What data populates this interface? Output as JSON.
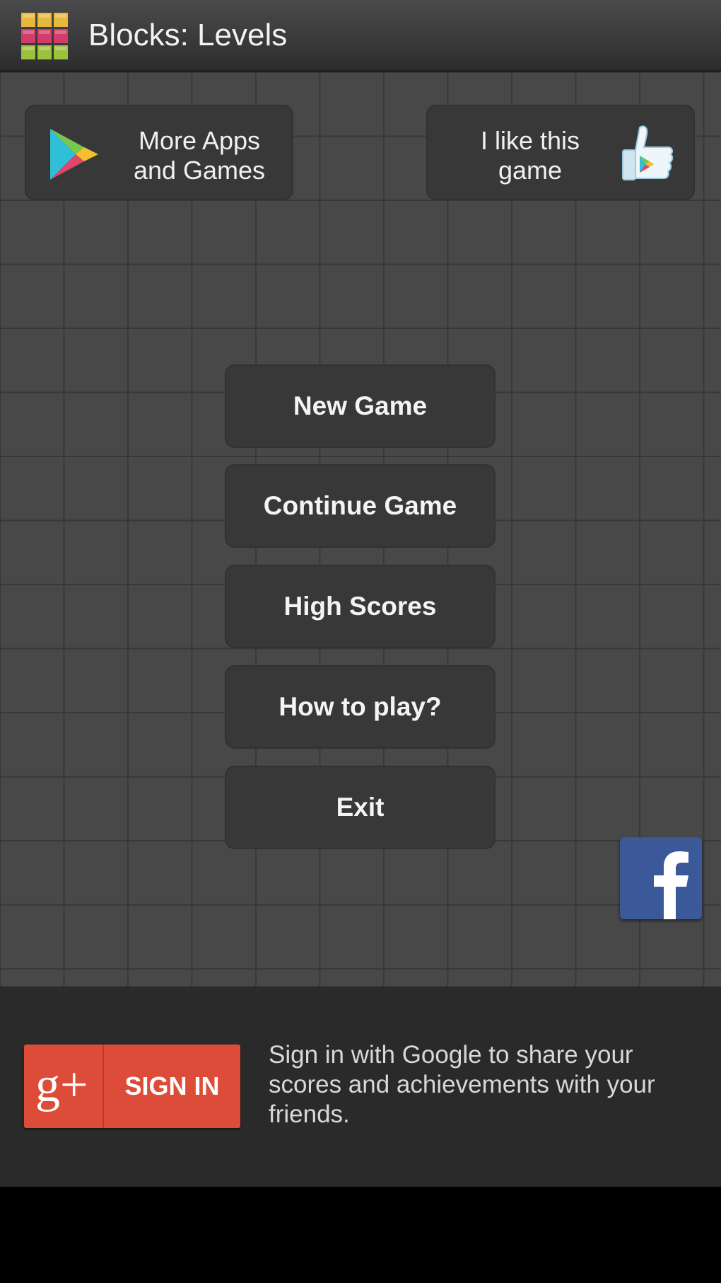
{
  "header": {
    "app_icon": "blocks-grid-icon",
    "title": "Blocks: Levels"
  },
  "promo": {
    "more_apps_label": "More Apps\nand Games",
    "more_apps_icon": "google-play-icon",
    "like_label": "I like this\ngame",
    "like_icon": "thumbs-up-play-icon"
  },
  "menu": {
    "items": [
      {
        "label": "New Game"
      },
      {
        "label": "Continue Game"
      },
      {
        "label": "High Scores"
      },
      {
        "label": "How to play?"
      },
      {
        "label": "Exit"
      }
    ]
  },
  "social": {
    "facebook_icon": "facebook-icon"
  },
  "signin": {
    "button_label": "SIGN IN",
    "gplus_logo": "g+",
    "description": "Sign in with Google to share your scores and achievements with your friends."
  },
  "colors": {
    "gplus_red": "#dd4b39",
    "facebook_blue": "#3b5998",
    "background_grid": "#484848",
    "button_bg": "#383838"
  }
}
